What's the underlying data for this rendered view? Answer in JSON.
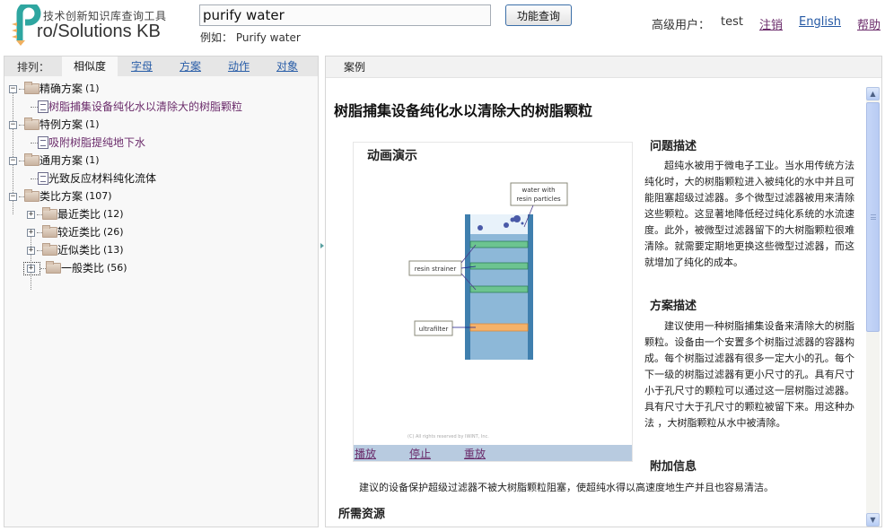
{
  "header": {
    "logo_subtitle": "技术创新知识库查询工具",
    "logo_title": "ro/Solutions KB",
    "search_value": "purify water",
    "search_button": "功能查询",
    "example_text": "例如：  Purify water",
    "user_label": "高级用户：",
    "username": "test",
    "logout_link": "注销",
    "language_link": "English",
    "help_link": "帮助"
  },
  "sidebar": {
    "sort_label": "排列：",
    "sort_tabs": [
      {
        "label": "相似度",
        "active": true
      },
      {
        "label": "字母",
        "active": false
      },
      {
        "label": "方案",
        "active": false
      },
      {
        "label": "动作",
        "active": false
      },
      {
        "label": "对象",
        "active": false
      }
    ],
    "tree": [
      {
        "label": "精确方案",
        "count": "(1)",
        "expanded": true,
        "children": [
          {
            "label": "树脂捕集设备纯化水以清除大的树脂颗粒"
          }
        ]
      },
      {
        "label": "特例方案",
        "count": "(1)",
        "expanded": true,
        "children": [
          {
            "label": "吸附树脂提纯地下水"
          }
        ]
      },
      {
        "label": "通用方案",
        "count": "(1)",
        "expanded": true,
        "children": [
          {
            "label": "光致反应材料纯化流体"
          }
        ]
      },
      {
        "label": "类比方案",
        "count": "(107)",
        "expanded": true,
        "children": [
          {
            "label": "最近类比",
            "count": "(12)"
          },
          {
            "label": "较近类比",
            "count": "(26)"
          },
          {
            "label": "近似类比",
            "count": "(13)"
          },
          {
            "label": "一般类比",
            "count": "(56)"
          }
        ]
      }
    ]
  },
  "main": {
    "tab_label": "案例",
    "case_title": "树脂捕集设备纯化水以清除大的树脂颗粒",
    "animation": {
      "title": "动画演示",
      "labels": {
        "water": [
          "water with",
          "resin particles"
        ],
        "strainer": "resin strainer",
        "ultrafilter": "ultrafilter"
      },
      "copyright": "(C) All rights reserved by IWINT, Inc.",
      "controls": [
        "播放",
        "停止",
        "重放"
      ]
    },
    "problem_heading": "问题描述",
    "problem_text": "超纯水被用于微电子工业。当水用传统方法纯化时，大的树脂颗粒进入被纯化的水中并且可能阻塞超级过滤器。多个微型过滤器被用来清除这些颗粒。这显著地降低经过纯化系统的水流速度。此外，被微型过滤器留下的大树脂颗粒很难清除。就需要定期地更换这些微型过滤器，而这就增加了纯化的成本。",
    "solution_heading": "方案描述",
    "solution_text": "建议使用一种树脂捕集设备来清除大的树脂颗粒。设备由一个安置多个树脂过滤器的容器构成。每个树脂过滤器有很多一定大小的孔。每个下一级的树脂过滤器有更小尺寸的孔。具有尺寸小于孔尺寸的颗粒可以通过这一层树脂过滤器。具有尺寸大于孔尺寸的颗粒被留下来。用这种办法 ，大树脂颗粒从水中被清除。",
    "extra_heading": "附加信息",
    "extra_text": "建议的设备保护超级过滤器不被大树脂颗粒阻塞，使超纯水得以高速度地生产并且也容易清洁。",
    "resources_heading": "所需资源"
  },
  "colors": {
    "visited_link": "#6b2c6b",
    "link_blue": "#2458a4",
    "controls_bar": "#b8cbe0"
  }
}
